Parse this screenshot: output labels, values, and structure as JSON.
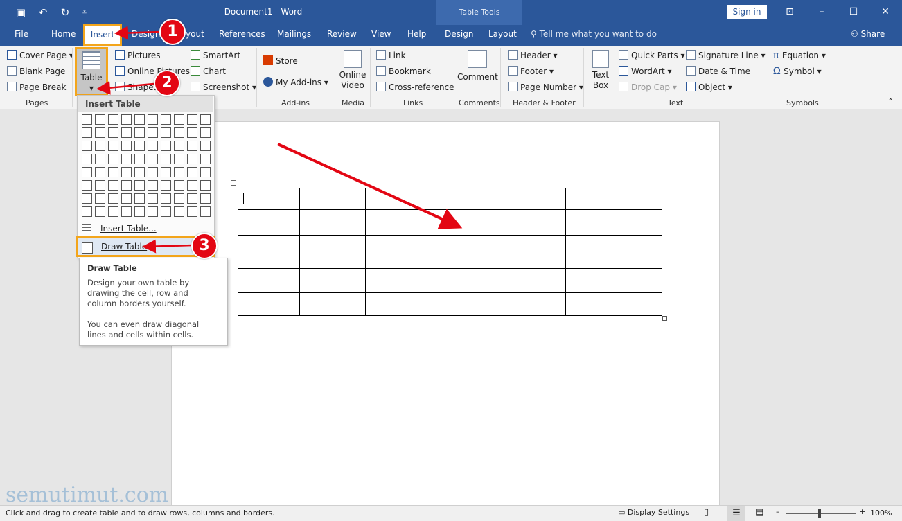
{
  "titlebar": {
    "doc_title": "Document1  -  Word",
    "context_label": "Table Tools",
    "signin": "Sign in",
    "icons": [
      "save-icon",
      "undo-icon",
      "redo-icon",
      "customize-icon"
    ]
  },
  "tabs": {
    "file": "File",
    "home": "Home",
    "insert": "Insert",
    "design": "Design",
    "layout": "Layout",
    "references": "References",
    "mailings": "Mailings",
    "review": "Review",
    "view": "View",
    "help": "Help",
    "ctx_design": "Design",
    "ctx_layout": "Layout",
    "tellme": "Tell me what you want to do",
    "share": "Share"
  },
  "ribbon": {
    "pages": {
      "label": "Pages",
      "cover": "Cover Page",
      "blank": "Blank Page",
      "break": "Page Break"
    },
    "table": {
      "label": "Table"
    },
    "illus": {
      "pictures": "Pictures",
      "online": "Online Pictures",
      "shapes": "Shapes",
      "smartart": "SmartArt",
      "chart": "Chart",
      "screenshot": "Screenshot"
    },
    "addins": {
      "label": "Add-ins",
      "store": "Store",
      "myaddins": "My Add-ins"
    },
    "media": {
      "label": "Media",
      "online_video": "Online Video"
    },
    "links": {
      "label": "Links",
      "link": "Link",
      "bookmark": "Bookmark",
      "xref": "Cross-reference"
    },
    "comments": {
      "label": "Comments",
      "comment": "Comment"
    },
    "hf": {
      "label": "Header & Footer",
      "header": "Header",
      "footer": "Footer",
      "pagenum": "Page Number"
    },
    "text": {
      "label": "Text",
      "textbox": "Text Box",
      "quickparts": "Quick Parts",
      "wordart": "WordArt",
      "dropcap": "Drop Cap",
      "sigline": "Signature Line",
      "datetime": "Date & Time",
      "object": "Object"
    },
    "symbols": {
      "label": "Symbols",
      "equation": "Equation",
      "symbol": "Symbol"
    }
  },
  "menu": {
    "header": "Insert Table",
    "insert_table": "Insert Table...",
    "draw_table": "Draw Table"
  },
  "tooltip": {
    "title": "Draw Table",
    "line1": "Design your own table by drawing the cell, row and column borders yourself.",
    "line2": "You can even draw diagonal lines and cells within cells."
  },
  "badges": {
    "one": "1",
    "two": "2",
    "three": "3"
  },
  "statusbar": {
    "message": "Click and drag to create table and to draw rows, columns and borders.",
    "display": "Display Settings",
    "zoom": "100%"
  },
  "watermark": "semutimut.com"
}
